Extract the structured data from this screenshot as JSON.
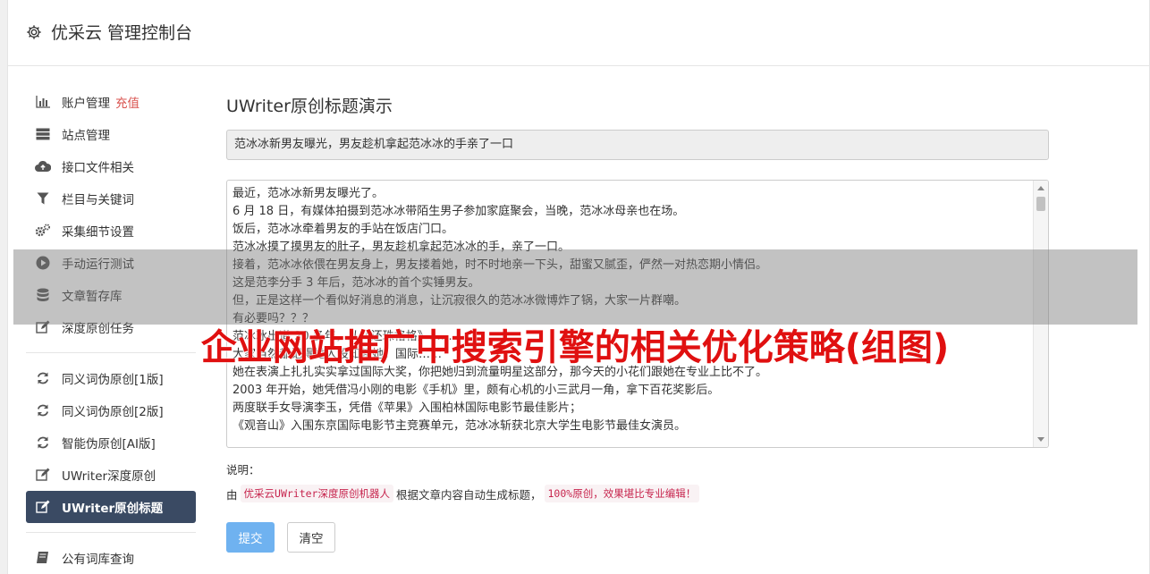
{
  "header": {
    "title": "优采云 管理控制台"
  },
  "sidebar": {
    "items": [
      {
        "label": "账户管理",
        "extra": "充值",
        "icon": "bar-chart-icon"
      },
      {
        "label": "站点管理",
        "icon": "server-icon"
      },
      {
        "label": "接口文件相关",
        "icon": "cloud-upload-icon"
      },
      {
        "label": "栏目与关键词",
        "icon": "filter-icon"
      },
      {
        "label": "采集细节设置",
        "icon": "cogs-icon"
      },
      {
        "label": "手动运行测试",
        "icon": "play-circle-icon"
      },
      {
        "label": "文章暂存库",
        "icon": "database-icon"
      },
      {
        "label": "深度原创任务",
        "icon": "edit-icon"
      }
    ],
    "items2": [
      {
        "label": "同义词伪原创[1版]",
        "icon": "refresh-icon"
      },
      {
        "label": "同义词伪原创[2版]",
        "icon": "refresh-icon"
      },
      {
        "label": "智能伪原创[AI版]",
        "icon": "refresh-icon"
      },
      {
        "label": "UWriter深度原创",
        "icon": "edit-icon"
      },
      {
        "label": "UWriter原创标题",
        "icon": "edit-icon"
      }
    ],
    "items3": [
      {
        "label": "公有词库查询",
        "icon": "book-icon"
      }
    ]
  },
  "main": {
    "page_title": "UWriter原创标题演示",
    "title_value": "范冰冰新男友曝光，男友趁机拿起范冰冰的手亲了一口",
    "content_lines": [
      "最近，范冰冰新男友曝光了。",
      "6 月 18 日，有媒体拍摄到范冰冰带陌生男子参加家庭聚会，当晚，范冰冰母亲也在场。",
      "饭后，范冰冰牵着男友的手站在饭店门口。",
      "范冰冰摸了摸男友的肚子，男友趁机拿起范冰冰的手，亲了一口。",
      "接着，范冰冰依偎在男友身上，男友搂着她，时不时地亲一下头，甜蜜又腻歪，俨然一对热恋期小情侣。",
      "这是范李分手 3 年后，范冰冰的首个实锤男友。",
      "但，正是这样一个看似好消息的消息，让沉寂很久的范冰冰微博炸了锅，大家一片群嘲。",
      "有必要吗？？？",
      "范冰冰出道 20 多年，从《还珠格格》……",
      "大家当然都记得她人设知晓她，国际……",
      "她在表演上扎扎实实拿过国际大奖，你把她归到流量明星这部分，那今天的小花们跟她在专业上比不了。",
      "2003 年开始，她凭借冯小刚的电影《手机》里，颇有心机的小三武月一角，拿下百花奖影后。",
      "两度联手女导演李玉，凭借《苹果》入围柏林国际电影节最佳影片；",
      "《观音山》入围东京国际电影节主竞赛单元，范冰冰斩获北京大学生电影节最佳女演员。"
    ],
    "note_label": "说明：",
    "note_prefix": "由",
    "note_chip1": "优采云UWriter深度原创机器人",
    "note_middle": "根据文章内容自动生成标题，",
    "note_chip2": "100%原创，效果堪比专业编辑！",
    "submit_label": "提交",
    "clear_label": "清空"
  },
  "watermark": "企业网站推广中搜索引擎的相关优化策略(组图)"
}
